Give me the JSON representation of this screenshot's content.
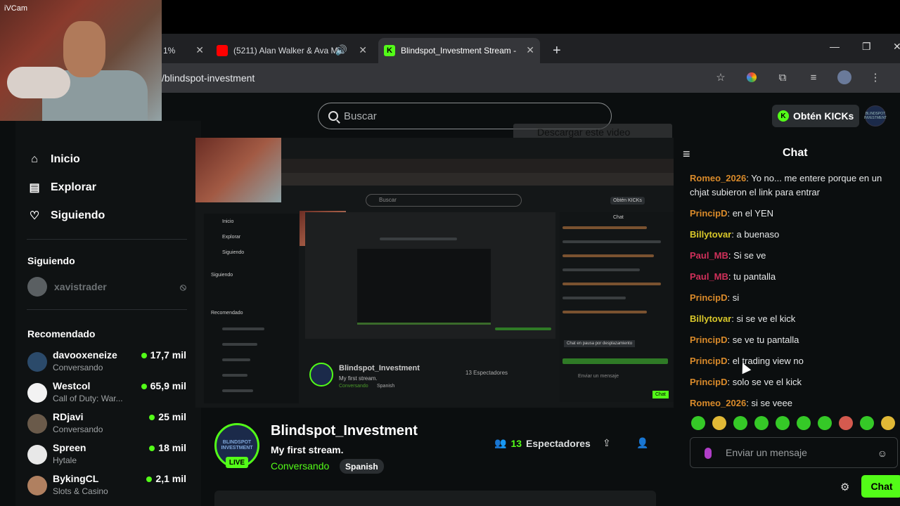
{
  "webcam": {
    "label": "iVCam"
  },
  "browser": {
    "tabs": [
      {
        "title": "1% "
      },
      {
        "title": "(5211) Alan Walker & Ava M"
      },
      {
        "title": "Blindspot_Investment Stream -"
      }
    ],
    "url": "/blindspot-investment"
  },
  "colors": {
    "accent": "#53fc18",
    "background": "#0b0e0f",
    "youtube": "#ff0000"
  },
  "header": {
    "search_placeholder": "Buscar",
    "kicks_button": "Obtén KICKs",
    "profile_avatar_text": "BLINDSPOT INVESTMENT"
  },
  "overlay": {
    "download_video": "Descargar este video"
  },
  "sidebar": {
    "nav": [
      {
        "label": "Inicio",
        "icon": "home-icon"
      },
      {
        "label": "Explorar",
        "icon": "browse-icon"
      },
      {
        "label": "Siguiendo",
        "icon": "heart-icon"
      }
    ],
    "following_title": "Siguiendo",
    "following": [
      {
        "name": "xavistrader"
      }
    ],
    "recommended_title": "Recomendado",
    "recommended": [
      {
        "name": "davooxeneize",
        "category": "Conversando",
        "viewers": "17,7 mil",
        "color": "#2b4a6a"
      },
      {
        "name": "Westcol",
        "category": "Call of Duty: War...",
        "viewers": "65,9 mil",
        "color": "#f2f2f2"
      },
      {
        "name": "RDjavi",
        "category": "Conversando",
        "viewers": "25 mil",
        "color": "#6a5a4a"
      },
      {
        "name": "Spreen",
        "category": "Hytale",
        "viewers": "18 mil",
        "color": "#e8e8e8"
      },
      {
        "name": "BykingCL",
        "category": "Slots & Casino",
        "viewers": "2,1 mil",
        "color": "#b08060"
      }
    ]
  },
  "nested": {
    "search": "Buscar",
    "kicks": "Obtén KICKs",
    "channel": "Blindspot_Investment",
    "title": "My first stream.",
    "category": "Conversando",
    "language": "Spanish",
    "viewers": "13 Espectadores",
    "chat_paused": "Chat en pausa por desplazamiento",
    "send": "Enviar un mensaje",
    "chat_button": "Chat",
    "chat_header": "Chat",
    "sidebar": [
      "Inicio",
      "Explorar",
      "Siguiendo"
    ],
    "following_title": "Siguiendo",
    "recommended_title": "Recomendado"
  },
  "channel": {
    "avatar_text": "BLINDSPOT INVESTMENT",
    "live": "LIVE",
    "name": "Blindspot_Investment",
    "title": "My first stream.",
    "category": "Conversando",
    "language": "Spanish",
    "viewer_count": "13",
    "viewer_label": "Espectadores"
  },
  "chat": {
    "title": "Chat",
    "messages": [
      {
        "user": "Romeo_2026",
        "text": "Yo no... me entere porque en un chjat subieron el link para entrar",
        "color": "#d98a2a"
      },
      {
        "user": "PrincipD",
        "text": "en el YEN",
        "color": "#d98a2a"
      },
      {
        "user": "Billytovar",
        "text": "a buenaso",
        "color": "#d9c82a"
      },
      {
        "user": "Paul_MB",
        "text": "Si se ve",
        "color": "#d0305a"
      },
      {
        "user": "Paul_MB",
        "text": "tu pantalla",
        "color": "#d0305a"
      },
      {
        "user": "PrincipD",
        "text": "si",
        "color": "#d98a2a"
      },
      {
        "user": "Billytovar",
        "text": "si se ve el kick",
        "color": "#d9c82a"
      },
      {
        "user": "PrincipD",
        "text": "se ve tu pantalla",
        "color": "#d98a2a"
      },
      {
        "user": "PrincipD",
        "text": "el trading view no",
        "color": "#d98a2a"
      },
      {
        "user": "PrincipD",
        "text": "solo se ve el kick",
        "color": "#d98a2a"
      },
      {
        "user": "Romeo_2026",
        "text": "si se veee",
        "color": "#d98a2a"
      }
    ],
    "input_placeholder": "Enviar un mensaje",
    "send_button": "Chat"
  }
}
